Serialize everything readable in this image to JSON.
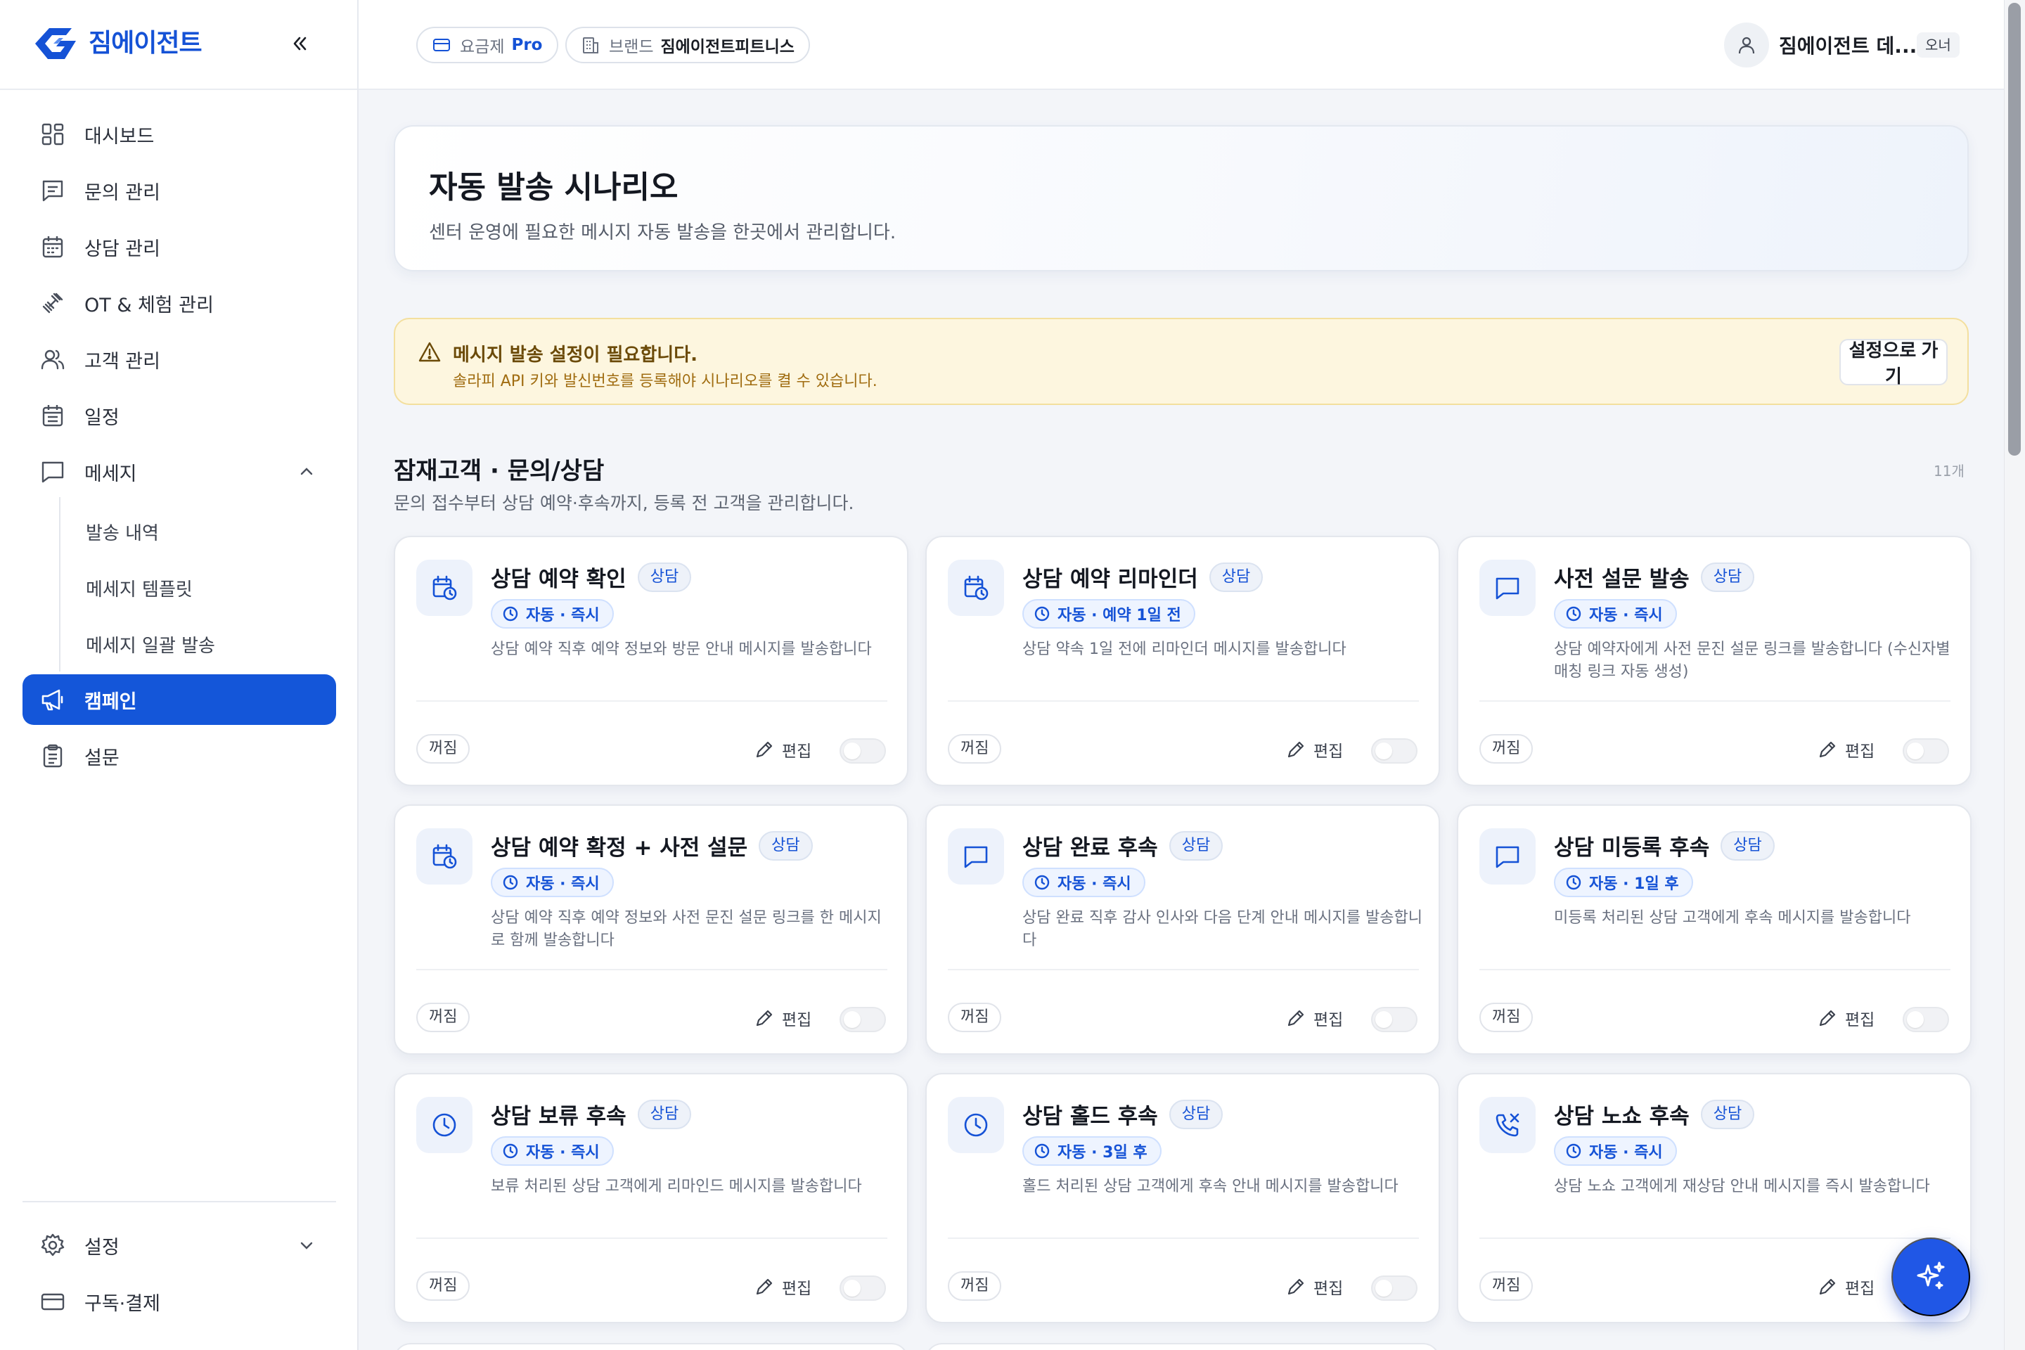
{
  "brand": {
    "name": "짐에이전트",
    "collapse_icon": "double-chevron-left-icon"
  },
  "sidebar": {
    "items": [
      {
        "label": "대시보드",
        "icon": "dashboard-icon"
      },
      {
        "label": "문의 관리",
        "icon": "inquiry-icon"
      },
      {
        "label": "상담 관리",
        "icon": "calendar-icon"
      },
      {
        "label": "OT & 체험 관리",
        "icon": "dumbbell-icon"
      },
      {
        "label": "고객 관리",
        "icon": "users-icon"
      },
      {
        "label": "일정",
        "icon": "schedule-icon"
      },
      {
        "label": "메세지",
        "icon": "message-icon",
        "expanded": true
      },
      {
        "label": "캠페인",
        "icon": "megaphone-icon",
        "active": true
      },
      {
        "label": "설문",
        "icon": "clipboard-icon"
      }
    ],
    "sub_items": [
      "발송 내역",
      "메세지 템플릿",
      "메세지 일괄 발송"
    ],
    "bottom": [
      {
        "label": "설정",
        "icon": "gear-icon"
      },
      {
        "label": "구독·결제",
        "icon": "card-icon"
      }
    ]
  },
  "topbar": {
    "plan_label": "요금제",
    "plan_value": "Pro",
    "brand_label": "브랜드",
    "brand_value": "짐에이전트피트니스",
    "user_name": "짐에이전트 데...",
    "user_role": "오너"
  },
  "hero": {
    "title": "자동 발송 시나리오",
    "subtitle": "센터 운영에 필요한 메시지 자동 발송을 한곳에서 관리합니다."
  },
  "alert": {
    "title": "메시지 발송 설정이 필요합니다.",
    "desc": "솔라피 API 키와 발신번호를 등록해야 시나리오를 켤 수 있습니다.",
    "button": "설정으로 가기"
  },
  "section": {
    "title": "잠재고객 · 문의/상담",
    "desc": "문의 접수부터 상담 예약·후속까지, 등록 전 고객을 관리합니다.",
    "count": "11개"
  },
  "card_common": {
    "state": "꺼짐",
    "edit": "편집"
  },
  "cards": [
    {
      "title": "상담 예약 확인",
      "tag": "상담",
      "auto": "자동 · 즉시",
      "desc": "상담 예약 직후 예약 정보와 방문 안내 메시지를 발송합니다",
      "icon": "calendar-clock-icon",
      "enabled": false
    },
    {
      "title": "상담 예약 리마인더",
      "tag": "상담",
      "auto": "자동 · 예약 1일 전",
      "desc": "상담 약속 1일 전에 리마인더 메시지를 발송합니다",
      "icon": "calendar-clock-icon",
      "enabled": false
    },
    {
      "title": "사전 설문 발송",
      "tag": "상담",
      "auto": "자동 · 즉시",
      "desc": "상담 예약자에게 사전 문진 설문 링크를 발송합니다 (수신자별 매칭 링크 자동 생성)",
      "icon": "chat-bubble-icon",
      "enabled": false
    },
    {
      "title": "상담 예약 확정 + 사전 설문",
      "tag": "상담",
      "auto": "자동 · 즉시",
      "desc": "상담 예약 직후 예약 정보와 사전 문진 설문 링크를 한 메시지로 함께 발송합니다",
      "icon": "calendar-clock-icon",
      "enabled": false
    },
    {
      "title": "상담 완료 후속",
      "tag": "상담",
      "auto": "자동 · 즉시",
      "desc": "상담 완료 직후 감사 인사와 다음 단계 안내 메시지를 발송합니다",
      "icon": "chat-bubble-icon",
      "enabled": false
    },
    {
      "title": "상담 미등록 후속",
      "tag": "상담",
      "auto": "자동 · 1일 후",
      "desc": "미등록 처리된 상담 고객에게 후속 메시지를 발송합니다",
      "icon": "chat-bubble-icon",
      "enabled": false
    },
    {
      "title": "상담 보류 후속",
      "tag": "상담",
      "auto": "자동 · 즉시",
      "desc": "보류 처리된 상담 고객에게 리마인드 메시지를 발송합니다",
      "icon": "clock-icon",
      "enabled": false
    },
    {
      "title": "상담 홀드 후속",
      "tag": "상담",
      "auto": "자동 · 3일 후",
      "desc": "홀드 처리된 상담 고객에게 후속 안내 메시지를 발송합니다",
      "icon": "clock-icon",
      "enabled": false
    },
    {
      "title": "상담 노쇼 후속",
      "tag": "상담",
      "auto": "자동 · 즉시",
      "desc": "상담 노쇼 고객에게 재상담 안내 메시지를 즉시 발송합니다",
      "icon": "phone-off-icon",
      "enabled": false
    }
  ],
  "fab_icon": "sparkle-icon",
  "colors": {
    "accent": "#1456d9",
    "warning_bg": "#fdf6df",
    "warning_text": "#6b4a08"
  }
}
